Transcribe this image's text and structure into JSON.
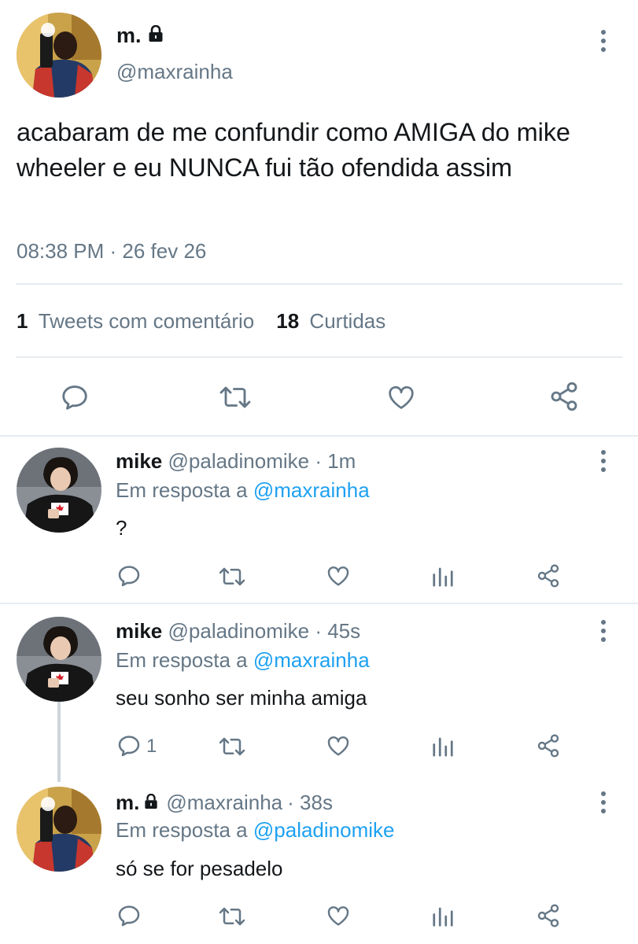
{
  "main_tweet": {
    "author": "m.",
    "handle": "@maxrainha",
    "text": "acabaram de me confundir como AMIGA do mike wheeler e eu NUNCA fui tão ofendida assim",
    "timestamp": "08:38 PM · 26 fev 26",
    "retweets_count": "1",
    "retweets_label": "Tweets com comentário",
    "likes_count": "18",
    "likes_label": "Curtidas"
  },
  "replies": [
    {
      "author": "mike",
      "handle": "@paladinomike",
      "time": "· 1m",
      "reply_prefix": "Em resposta a",
      "reply_to": "@maxrainha",
      "text": "?",
      "reply_count": ""
    },
    {
      "author": "mike",
      "handle": "@paladinomike",
      "time": "· 45s",
      "reply_prefix": "Em resposta a",
      "reply_to": "@maxrainha",
      "text": "seu sonho ser minha amiga",
      "reply_count": "1"
    },
    {
      "author": "m.",
      "handle": "@maxrainha",
      "time": "· 38s",
      "reply_prefix": "Em resposta a",
      "reply_to": "@paladinomike",
      "text": "só se for pesadelo",
      "reply_count": ""
    }
  ],
  "icons": [
    "lock-icon",
    "more-icon",
    "reply-icon",
    "retweet-icon",
    "like-icon",
    "analytics-icon",
    "share-icon"
  ],
  "colors": {
    "text": "#14171a",
    "secondary": "#657786",
    "link": "#1da1f2",
    "divider": "#e6ecf0"
  }
}
